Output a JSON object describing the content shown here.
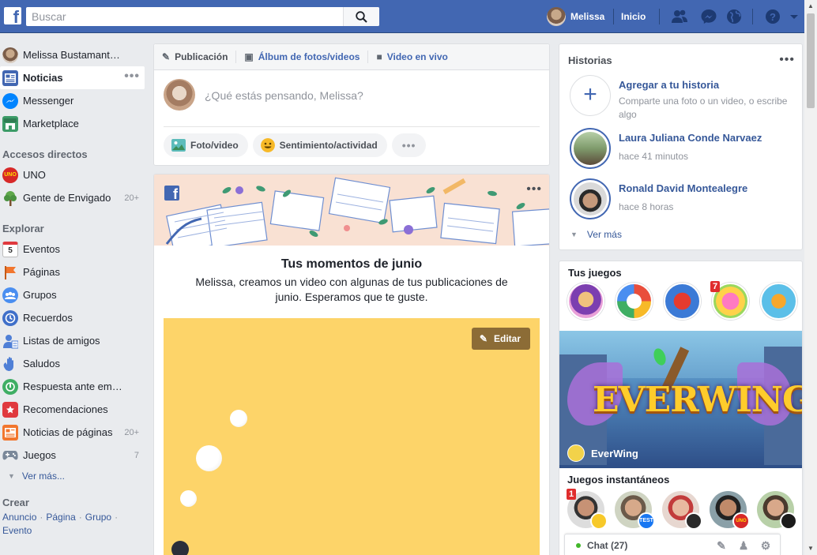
{
  "topbar": {
    "search_placeholder": "Buscar",
    "user_name": "Melissa",
    "home_label": "Inicio",
    "icons": [
      "friend-requests-icon",
      "messenger-icon",
      "notifications-globe-icon",
      "help-icon",
      "account-menu-icon"
    ]
  },
  "leftnav": {
    "profile_name": "Melissa Bustamant…",
    "items": [
      {
        "label": "Noticias",
        "icon": "news-feed-icon",
        "color": "#4267b2"
      },
      {
        "label": "Messenger",
        "icon": "messenger-icon",
        "color": "#0084ff"
      },
      {
        "label": "Marketplace",
        "icon": "marketplace-icon",
        "color": "#3c9b67"
      }
    ],
    "shortcuts_header": "Accesos directos",
    "shortcuts": [
      {
        "label": "UNO",
        "icon": "uno-game-icon",
        "count": ""
      },
      {
        "label": "Gente de Envigado",
        "icon": "group-tree-icon",
        "count": "20+"
      }
    ],
    "explore_header": "Explorar",
    "explore": [
      {
        "label": "Eventos",
        "icon": "calendar-icon",
        "count": ""
      },
      {
        "label": "Páginas",
        "icon": "flag-icon",
        "count": ""
      },
      {
        "label": "Grupos",
        "icon": "groups-icon",
        "count": ""
      },
      {
        "label": "Recuerdos",
        "icon": "memories-clock-icon",
        "count": ""
      },
      {
        "label": "Listas de amigos",
        "icon": "friend-lists-icon",
        "count": ""
      },
      {
        "label": "Saludos",
        "icon": "wave-hand-icon",
        "count": ""
      },
      {
        "label": "Respuesta ante em…",
        "icon": "crisis-response-icon",
        "count": ""
      },
      {
        "label": "Recomendaciones",
        "icon": "recommendations-icon",
        "count": ""
      },
      {
        "label": "Noticias de páginas",
        "icon": "pages-feed-icon",
        "count": "20+"
      },
      {
        "label": "Juegos",
        "icon": "gamepad-icon",
        "count": "7"
      }
    ],
    "more_label": "Ver más...",
    "create_header": "Crear",
    "create_links": [
      "Anuncio",
      "Página",
      "Grupo",
      "Evento"
    ]
  },
  "composer": {
    "tabs": [
      "Publicación",
      "Álbum de fotos/videos",
      "Video en vivo"
    ],
    "placeholder": "¿Qué estás pensando, Melissa?",
    "actions": [
      "Foto/video",
      "Sentimiento/actividad"
    ]
  },
  "memory_card": {
    "title": "Tus momentos de junio",
    "subtitle": "Melissa, creamos un video con algunas de tus publicaciones de junio. Esperamos que te guste.",
    "edit_label": "Editar"
  },
  "stories": {
    "header": "Historias",
    "add_title": "Agregar a tu historia",
    "add_subtitle": "Comparte una foto o un video, o escribe algo",
    "items": [
      {
        "name": "Laura Juliana Conde Narvaez",
        "time": "hace 41 minutos"
      },
      {
        "name": "Ronald David Montealegre",
        "time": "hace 8 horas"
      }
    ],
    "more_label": "Ver más"
  },
  "games": {
    "header": "Tus juegos",
    "game_badge": "7",
    "featured_name": "EverWing",
    "featured_art_text": "EVERWING",
    "instant_header": "Juegos instantáneos",
    "instant_badge": "1",
    "sub_labels": [
      "TEST",
      "UNO"
    ]
  },
  "chat": {
    "label": "Chat (27)"
  }
}
